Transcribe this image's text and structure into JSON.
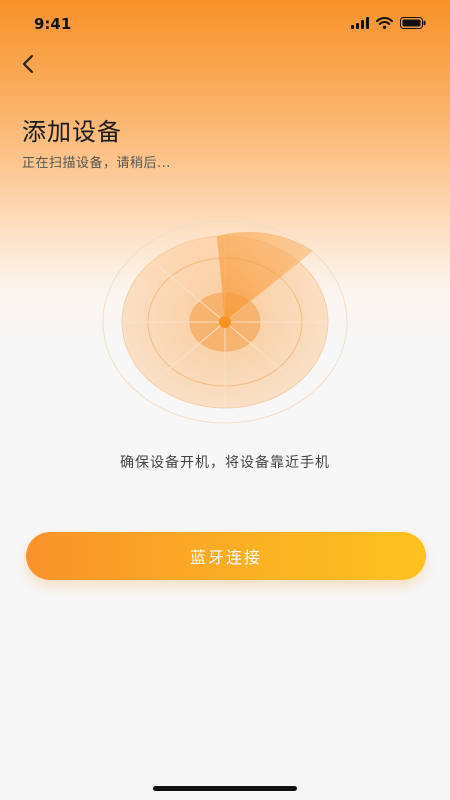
{
  "status": {
    "time": "9:41"
  },
  "header": {
    "title": "添加设备",
    "subtitle": "正在扫描设备，请稍后..."
  },
  "main": {
    "hint": "确保设备开机，将设备靠近手机",
    "button_label": "蓝牙连接"
  },
  "colors": {
    "accent": "#f9922a",
    "accent_light": "#fcc21f"
  },
  "icons": {
    "back": "chevron-left-icon",
    "signal": "cellular-signal-icon",
    "wifi": "wifi-icon",
    "battery": "battery-icon"
  }
}
